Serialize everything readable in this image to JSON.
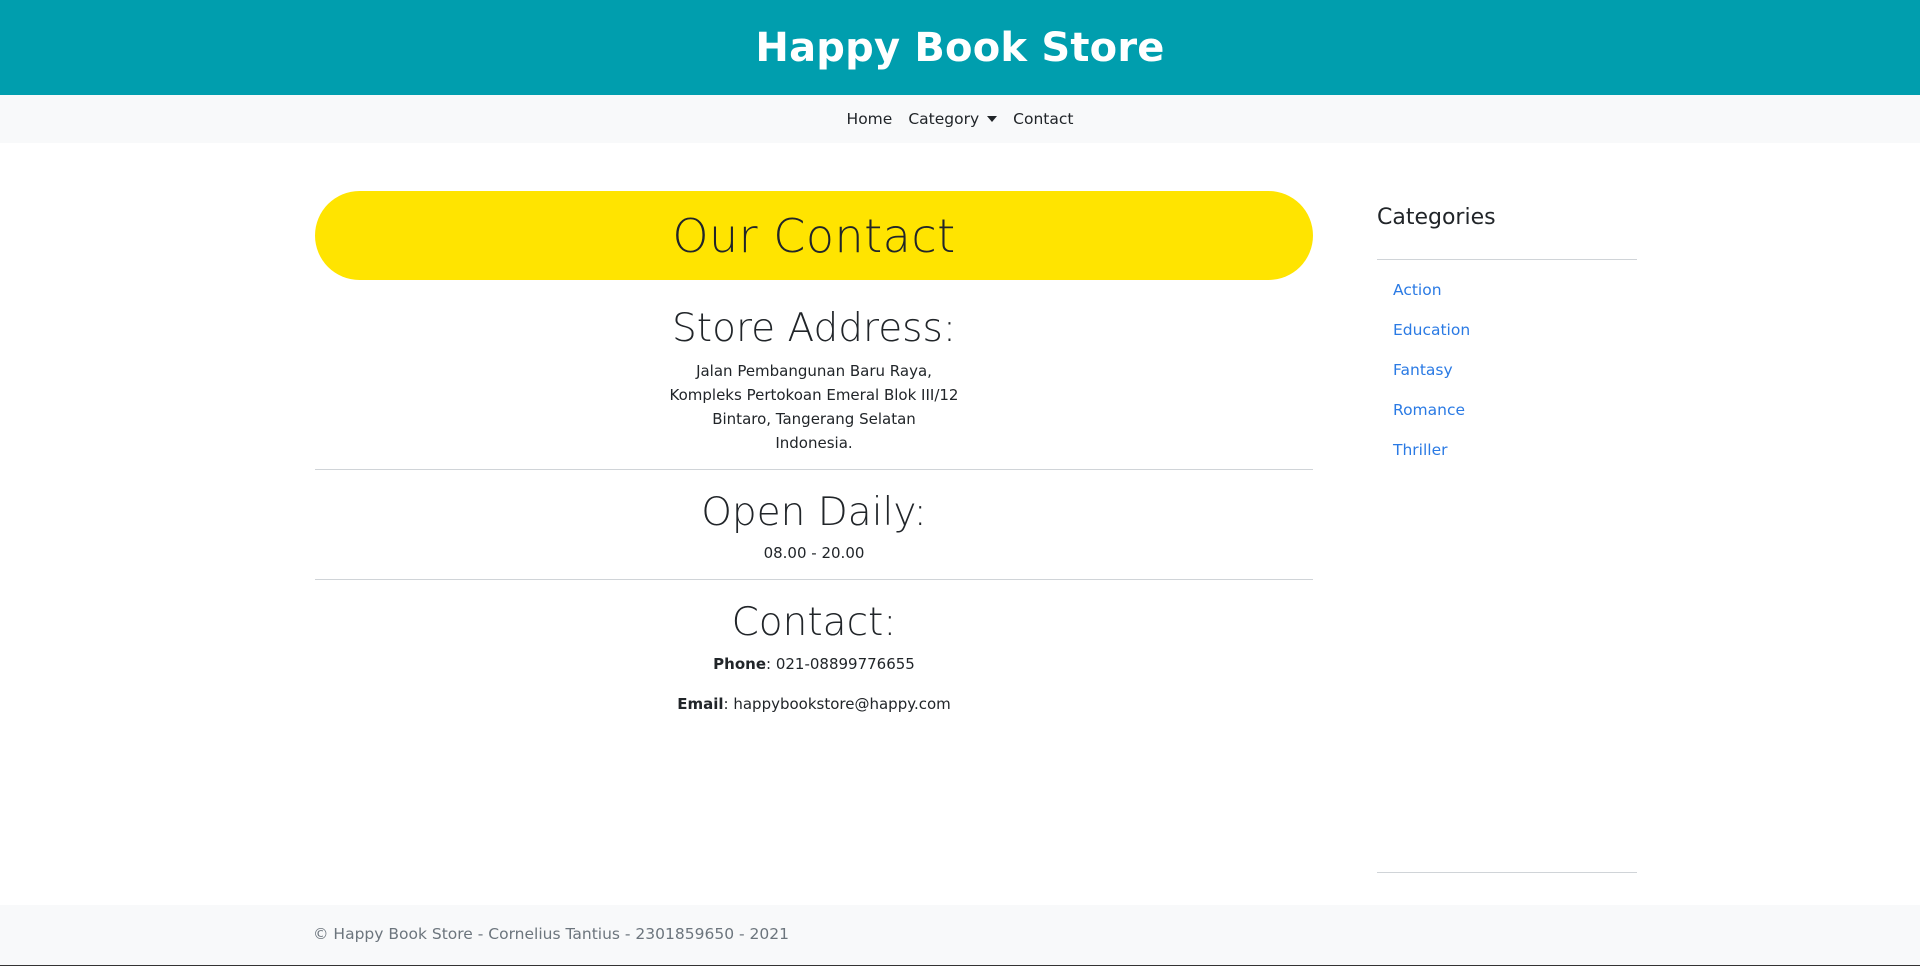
{
  "header": {
    "title": "Happy Book Store"
  },
  "nav": {
    "items": [
      {
        "label": "Home"
      },
      {
        "label": "Category"
      },
      {
        "label": "Contact"
      }
    ]
  },
  "main": {
    "banner_title": "Our Contact",
    "address": {
      "heading": "Store Address:",
      "lines": [
        "Jalan Pembangunan Baru Raya,",
        "Kompleks Pertokoan Emeral Blok III/12",
        "Bintaro, Tangerang Selatan",
        "Indonesia."
      ]
    },
    "hours": {
      "heading": "Open Daily:",
      "value": "08.00 - 20.00"
    },
    "contact": {
      "heading": "Contact:",
      "phone_label": "Phone",
      "phone_value": ": 021-08899776655",
      "email_label": "Email",
      "email_value": ": happybookstore@happy.com"
    }
  },
  "sidebar": {
    "title": "Categories",
    "items": [
      {
        "label": "Action"
      },
      {
        "label": "Education"
      },
      {
        "label": "Fantasy"
      },
      {
        "label": "Romance"
      },
      {
        "label": "Thriller"
      }
    ]
  },
  "footer": {
    "text": "© Happy Book Store - Cornelius Tantius - 2301859650 - 2021"
  },
  "colors": {
    "header_bg": "#009eae",
    "banner_bg": "#ffe400",
    "link": "#2a7ae4",
    "nav_bg": "#f8f9fa"
  }
}
